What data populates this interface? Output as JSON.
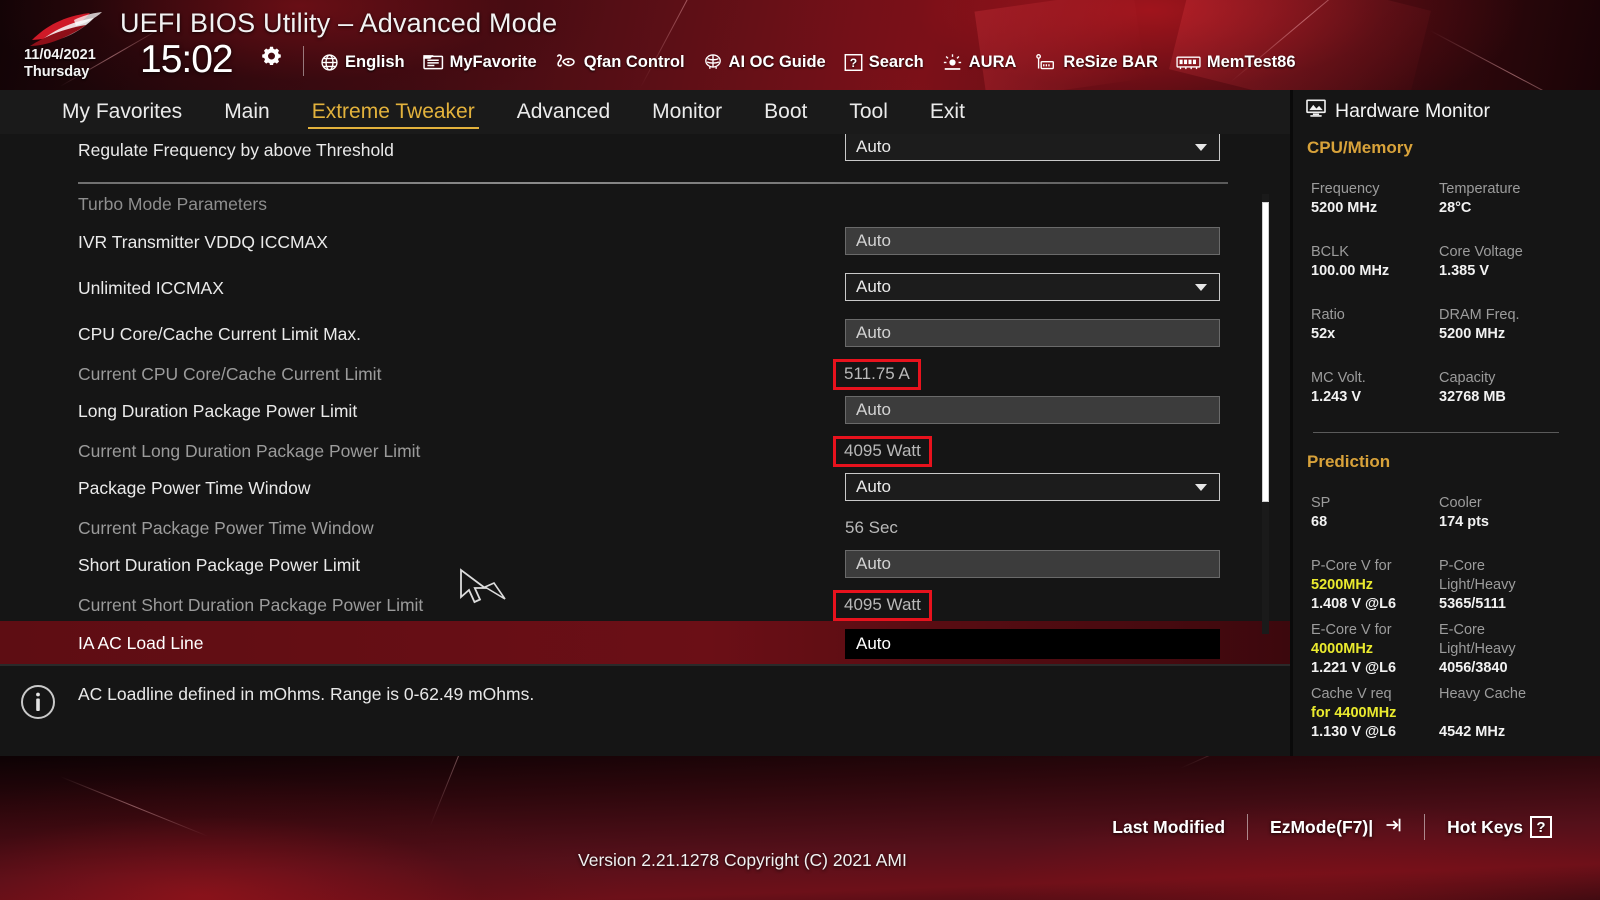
{
  "header": {
    "logo_icon": "rog-logo-icon",
    "title": "UEFI BIOS Utility – Advanced Mode",
    "date": "11/04/2021",
    "weekday": "Thursday",
    "time": "15:02",
    "gear_icon": "gear-icon",
    "tools": [
      {
        "label": "English",
        "icon": "globe-icon"
      },
      {
        "label": "MyFavorite",
        "icon": "favorite-folder-icon"
      },
      {
        "label": "Qfan Control",
        "icon": "fan-icon"
      },
      {
        "label": "AI OC Guide",
        "icon": "ai-brain-icon"
      },
      {
        "label": "Search",
        "icon": "question-box-icon"
      },
      {
        "label": "AURA",
        "icon": "aura-light-icon"
      },
      {
        "label": "ReSize BAR",
        "icon": "resize-bar-icon"
      },
      {
        "label": "MemTest86",
        "icon": "memory-module-icon"
      }
    ]
  },
  "nav": {
    "tabs": [
      {
        "label": "My Favorites",
        "active": false
      },
      {
        "label": "Main",
        "active": false
      },
      {
        "label": "Extreme Tweaker",
        "active": true
      },
      {
        "label": "Advanced",
        "active": false
      },
      {
        "label": "Monitor",
        "active": false
      },
      {
        "label": "Boot",
        "active": false
      },
      {
        "label": "Tool",
        "active": false
      },
      {
        "label": "Exit",
        "active": false
      }
    ]
  },
  "settings": {
    "rows": [
      {
        "label": "Regulate Frequency by above Threshold",
        "kind": "combo",
        "value": "Auto",
        "style": "normal"
      },
      {
        "label": "",
        "kind": "separator"
      },
      {
        "label": "Turbo Mode Parameters",
        "kind": "none",
        "value": "",
        "style": "head"
      },
      {
        "label": "IVR Transmitter VDDQ ICCMAX",
        "kind": "filled",
        "value": "Auto",
        "style": "normal"
      },
      {
        "label": "Unlimited ICCMAX",
        "kind": "combo",
        "value": "Auto",
        "style": "normal"
      },
      {
        "label": "CPU Core/Cache Current Limit Max.",
        "kind": "filled",
        "value": "Auto",
        "style": "normal"
      },
      {
        "label": "Current CPU Core/Cache Current Limit",
        "kind": "boxed",
        "value": "511.75 A",
        "style": "dim"
      },
      {
        "label": "Long Duration Package Power Limit",
        "kind": "filled",
        "value": "Auto",
        "style": "normal"
      },
      {
        "label": "Current Long Duration Package Power Limit",
        "kind": "boxed",
        "value": "4095 Watt",
        "style": "dim"
      },
      {
        "label": "Package Power Time Window",
        "kind": "combo",
        "value": "Auto",
        "style": "normal"
      },
      {
        "label": "Current Package Power Time Window",
        "kind": "readonly",
        "value": "56 Sec",
        "style": "dim"
      },
      {
        "label": "Short Duration Package Power Limit",
        "kind": "filled",
        "value": "Auto",
        "style": "normal"
      },
      {
        "label": "Current Short Duration Package Power Limit",
        "kind": "boxed",
        "value": "4095 Watt",
        "style": "dim"
      },
      {
        "label": "IA AC Load Line",
        "kind": "selected",
        "value": "Auto",
        "style": "sel"
      }
    ],
    "highlight_color": "#e8121d",
    "selected_row_color": "#6b0f16"
  },
  "info": {
    "icon": "info-circle-icon",
    "text": "AC Loadline defined in mOhms. Range is 0-62.49 mOhms."
  },
  "sidebar": {
    "title": "Hardware Monitor",
    "title_icon": "monitor-icon",
    "sections": [
      {
        "name": "CPU/Memory",
        "pairs": [
          {
            "k1": "Frequency",
            "v1": "5200 MHz",
            "k2": "Temperature",
            "v2": "28°C"
          },
          {
            "k1": "BCLK",
            "v1": "100.00 MHz",
            "k2": "Core Voltage",
            "v2": "1.385 V"
          },
          {
            "k1": "Ratio",
            "v1": "52x",
            "k2": "DRAM Freq.",
            "v2": "5200 MHz"
          },
          {
            "k1": "MC Volt.",
            "v1": "1.243 V",
            "k2": "Capacity",
            "v2": "32768 MB"
          }
        ]
      },
      {
        "name": "Prediction",
        "pairs": [
          {
            "k1": "SP",
            "v1": "68",
            "k2": "Cooler",
            "v2": "174 pts"
          }
        ],
        "predictions": [
          {
            "k1a": "P-Core V for",
            "k1b": "5200MHz",
            "v1": "1.408 V @L6",
            "k2a": "P-Core",
            "k2b": "Light/Heavy",
            "v2": "5365/5111"
          },
          {
            "k1a": "E-Core V for",
            "k1b": "4000MHz",
            "v1": "1.221 V @L6",
            "k2a": "E-Core",
            "k2b": "Light/Heavy",
            "v2": "4056/3840"
          },
          {
            "k1a": "Cache V req",
            "k1b": "for 4400MHz",
            "v1": "1.130 V @L6",
            "k2a": "Heavy Cache",
            "k2b": "",
            "v2": "4542 MHz"
          }
        ]
      }
    ],
    "accent_color": "#d8a23a",
    "highlight_color": "#eaea2e"
  },
  "footer": {
    "version": "Version 2.21.1278 Copyright (C) 2021 AMI",
    "links": [
      {
        "label": "Last Modified",
        "icon": ""
      },
      {
        "label": "EzMode(F7)|",
        "icon": "arrow-into-box-icon"
      },
      {
        "label": "Hot Keys",
        "icon": "question-box-icon"
      }
    ]
  }
}
